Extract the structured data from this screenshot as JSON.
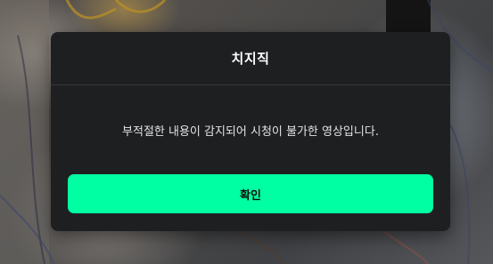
{
  "modal": {
    "title": "치지직",
    "message": "부적절한 내용이 감지되어 시청이 불가한 영상입니다.",
    "confirm_label": "확인"
  },
  "colors": {
    "modal_background": "#1e1f21",
    "accent": "#00fea2",
    "title_text": "#ffffff",
    "message_text": "#e3e3e3"
  }
}
